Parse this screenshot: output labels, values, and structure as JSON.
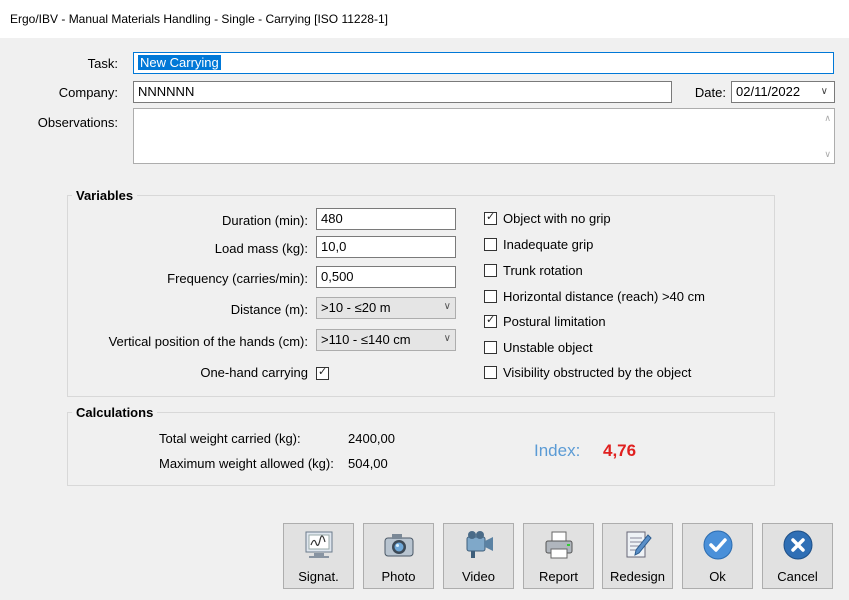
{
  "window": {
    "title": "Ergo/IBV - Manual Materials Handling - Single - Carrying [ISO 11228-1]"
  },
  "form": {
    "task_label": "Task:",
    "task_value": "New Carrying",
    "company_label": "Company:",
    "company_value": "NNNNNN",
    "date_label": "Date:",
    "date_value": "02/11/2022",
    "observations_label": "Observations:",
    "observations_value": ""
  },
  "variables": {
    "title": "Variables",
    "duration_label": "Duration (min):",
    "duration_value": "480",
    "load_mass_label": "Load mass (kg):",
    "load_mass_value": "10,0",
    "frequency_label": "Frequency (carries/min):",
    "frequency_value": "0,500",
    "distance_label": "Distance (m):",
    "distance_value": ">10 - ≤20 m",
    "vertical_label": "Vertical position of the hands (cm):",
    "vertical_value": ">110 - ≤140 cm",
    "one_hand_label": "One-hand carrying",
    "one_hand_checked": true,
    "checks": [
      {
        "label": "Object with no grip",
        "checked": true
      },
      {
        "label": "Inadequate grip",
        "checked": false
      },
      {
        "label": "Trunk rotation",
        "checked": false
      },
      {
        "label": "Horizontal distance (reach) >40 cm",
        "checked": false
      },
      {
        "label": "Postural limitation",
        "checked": true
      },
      {
        "label": "Unstable object",
        "checked": false
      },
      {
        "label": "Visibility obstructed by the object",
        "checked": false
      }
    ]
  },
  "calculations": {
    "title": "Calculations",
    "total_weight_label": "Total weight carried (kg):",
    "total_weight_value": "2400,00",
    "max_weight_label": "Maximum weight allowed (kg):",
    "max_weight_value": "504,00",
    "index_label": "Index:",
    "index_value": "4,76"
  },
  "buttons": {
    "signat": "Signat.",
    "photo": "Photo",
    "video": "Video",
    "report": "Report",
    "redesign": "Redesign",
    "ok": "Ok",
    "cancel": "Cancel"
  },
  "colors": {
    "accent": "#0078d7",
    "index_label": "#5b9bd5",
    "index_value": "#e0201f",
    "ok_icon": "#4a90d9",
    "cancel_icon": "#2f6fb5"
  }
}
